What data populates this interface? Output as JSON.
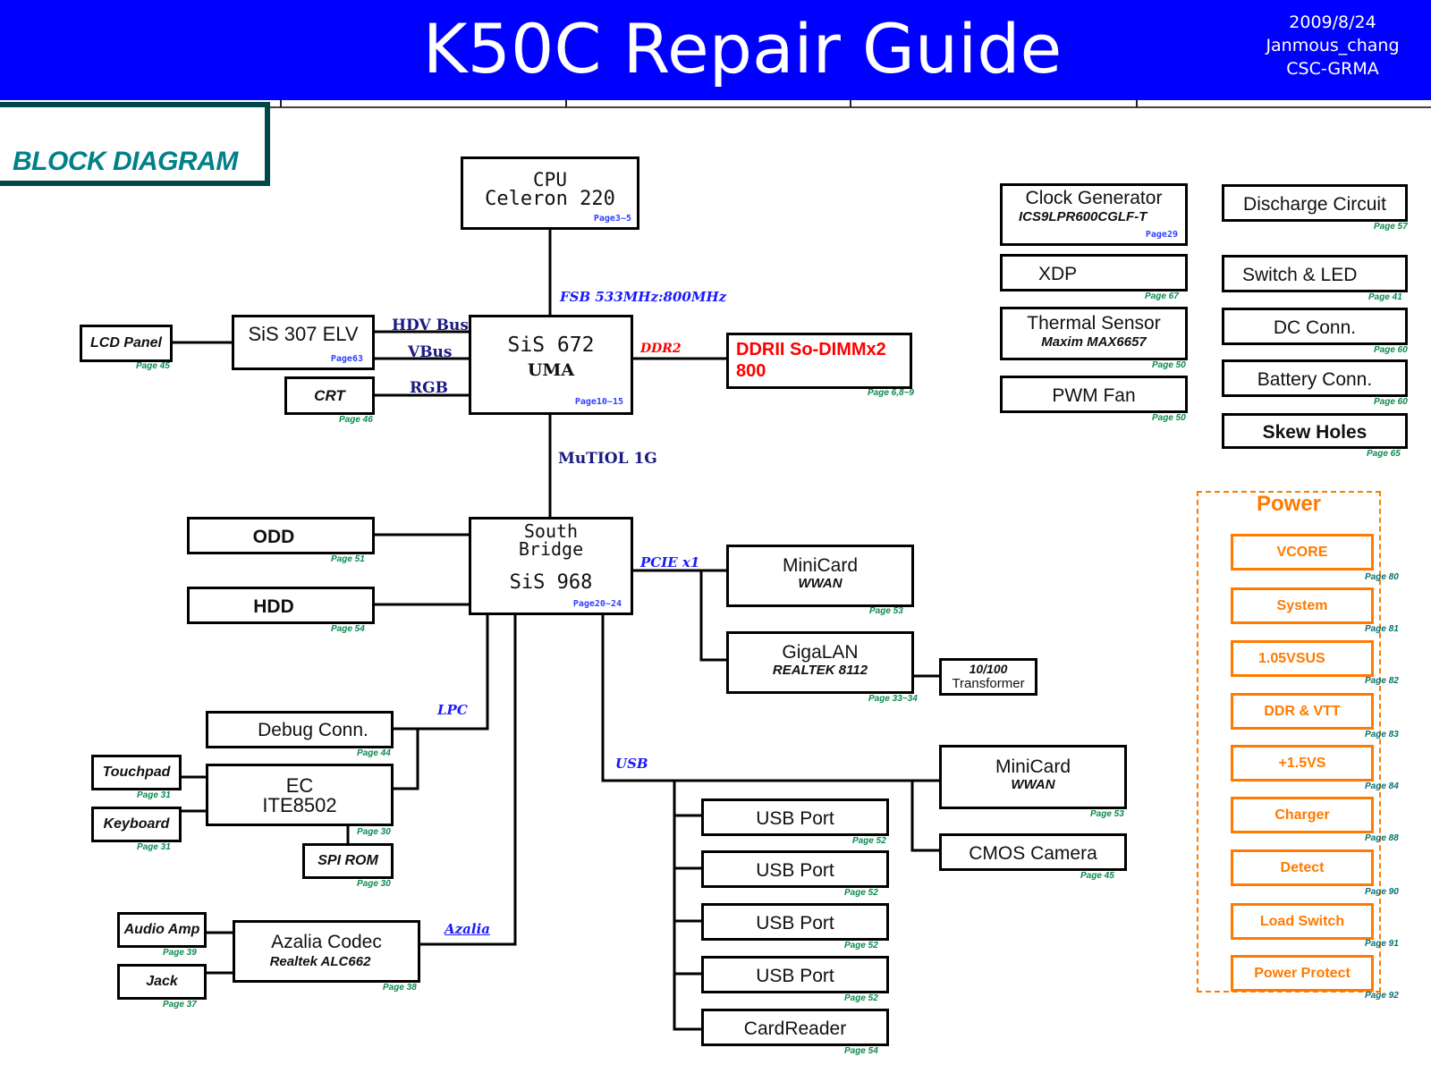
{
  "header": {
    "title": "K50C Repair Guide",
    "date": "2009/8/24",
    "author": "Janmous_chang",
    "dept": "CSC-GRMA",
    "background_color": "#0000ff"
  },
  "diagram_title": "BLOCK DIAGRAM",
  "colors": {
    "box_border": "#000000",
    "power_accent": "#ff7a00",
    "page_ref": "#0a8a50",
    "bus_label_blue": "#1a1aff",
    "ddr_red": "#ff0000"
  },
  "blocks": {
    "cpu": {
      "line1": "CPU",
      "line2": "Celeron 220",
      "page": "Page3~5"
    },
    "northbridge": {
      "line1": "SiS 672",
      "line2": "UMA",
      "page": "Page10~15"
    },
    "southbridge": {
      "line1": "South",
      "line2": "Bridge",
      "line3": "SiS 968",
      "page": "Page20~24"
    },
    "sis307": {
      "label": "SiS 307 ELV",
      "page": "Page63"
    },
    "lcd": {
      "label": "LCD Panel",
      "page": "Page 45"
    },
    "crt": {
      "label": "CRT",
      "page": "Page 46"
    },
    "ddr": {
      "line1": "DDRII So-DIMMx2",
      "line2": "800",
      "page": "Page 6,8~9"
    },
    "odd": {
      "label": "ODD",
      "page": "Page 51"
    },
    "hdd": {
      "label": "HDD",
      "page": "Page 54"
    },
    "minicard_pcie": {
      "line1": "MiniCard",
      "line2": "WWAN",
      "page": "Page 53"
    },
    "gigalan": {
      "line1": "GigaLAN",
      "line2": "REALTEK 8112",
      "page": "Page 33~34"
    },
    "transformer": {
      "line1": "10/100",
      "line2": "Transformer"
    },
    "debug": {
      "label": "Debug Conn.",
      "page": "Page 44"
    },
    "ec": {
      "line1": "EC",
      "line2": "ITE8502",
      "page": "Page 30"
    },
    "touchpad": {
      "label": "Touchpad",
      "page": "Page 31"
    },
    "keyboard": {
      "label": "Keyboard",
      "page": "Page 31"
    },
    "spirom": {
      "label": "SPI ROM",
      "page": "Page 30"
    },
    "audioamp": {
      "label": "Audio Amp",
      "page": "Page 39"
    },
    "jack": {
      "label": "Jack",
      "page": "Page 37"
    },
    "azalia": {
      "line1": "Azalia Codec",
      "line2": "Realtek ALC662",
      "page": "Page 38"
    },
    "minicard_usb": {
      "line1": "MiniCard",
      "line2": "WWAN",
      "page": "Page 53"
    },
    "cmos": {
      "label": "CMOS Camera",
      "page": "Page 45"
    },
    "usb_ports": [
      {
        "label": "USB Port",
        "page": "Page 52"
      },
      {
        "label": "USB Port",
        "page": "Page 52"
      },
      {
        "label": "USB Port",
        "page": "Page 52"
      },
      {
        "label": "USB Port",
        "page": "Page 52"
      }
    ],
    "cardreader": {
      "label": "CardReader",
      "page": "Page 54"
    },
    "clockgen": {
      "line1": "Clock Generator",
      "line2": "ICS9LPR600CGLF-T",
      "page": "Page29"
    },
    "xdp": {
      "label": "XDP",
      "page": "Page 67"
    },
    "thermal": {
      "line1": "Thermal Sensor",
      "line2": "Maxim MAX6657",
      "page": "Page 50"
    },
    "pwmfan": {
      "label": "PWM Fan",
      "page": "Page 50"
    },
    "discharge": {
      "label": "Discharge Circuit",
      "page": "Page 57"
    },
    "switchled": {
      "label": "Switch & LED",
      "page": "Page 41"
    },
    "dcconn": {
      "label": "DC Conn.",
      "page": "Page 60"
    },
    "battconn": {
      "label": "Battery Conn.",
      "page": "Page 60"
    },
    "skew": {
      "label": "Skew Holes",
      "page": "Page 65"
    }
  },
  "buses": {
    "fsb": "FSB 533MHz:800MHz",
    "hdv": "HDV Bus",
    "vbus": "VBus",
    "rgb": "RGB",
    "ddr2": "DDR2",
    "mutiol": "MuTIOL 1G",
    "pcie": "PCIE x1",
    "lpc": "LPC",
    "usb": "USB",
    "azalia": "Azalia"
  },
  "power": {
    "title": "Power",
    "items": [
      {
        "label": "VCORE",
        "page": "Page 80"
      },
      {
        "label": "System",
        "page": "Page 81"
      },
      {
        "label": "1.05VSUS",
        "page": "Page 82"
      },
      {
        "label": "DDR & VTT",
        "page": "Page 83"
      },
      {
        "label": "+1.5VS",
        "page": "Page 84"
      },
      {
        "label": "Charger",
        "page": "Page 88"
      },
      {
        "label": "Detect",
        "page": "Page 90"
      },
      {
        "label": "Load Switch",
        "page": "Page 91"
      },
      {
        "label": "Power Protect",
        "page": "Page 92"
      }
    ]
  }
}
